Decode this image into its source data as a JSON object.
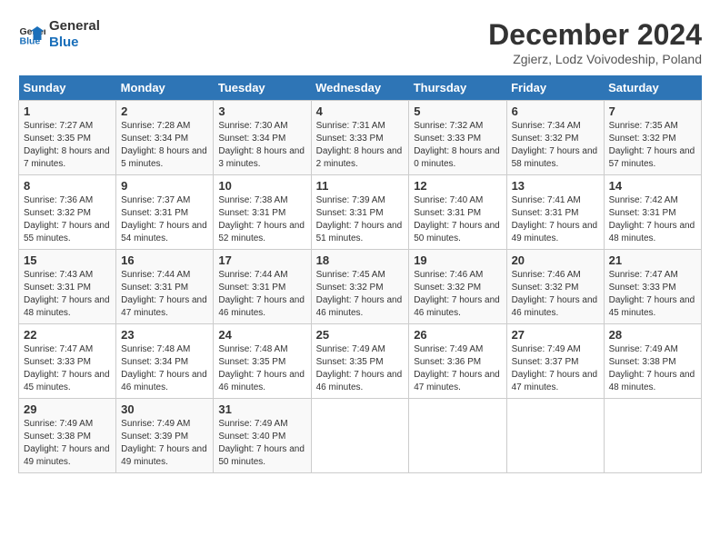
{
  "logo": {
    "line1": "General",
    "line2": "Blue"
  },
  "title": "December 2024",
  "subtitle": "Zgierz, Lodz Voivodeship, Poland",
  "days_of_week": [
    "Sunday",
    "Monday",
    "Tuesday",
    "Wednesday",
    "Thursday",
    "Friday",
    "Saturday"
  ],
  "weeks": [
    [
      {
        "day": "1",
        "sunrise": "7:27 AM",
        "sunset": "3:35 PM",
        "daylight": "8 hours and 7 minutes."
      },
      {
        "day": "2",
        "sunrise": "7:28 AM",
        "sunset": "3:34 PM",
        "daylight": "8 hours and 5 minutes."
      },
      {
        "day": "3",
        "sunrise": "7:30 AM",
        "sunset": "3:34 PM",
        "daylight": "8 hours and 3 minutes."
      },
      {
        "day": "4",
        "sunrise": "7:31 AM",
        "sunset": "3:33 PM",
        "daylight": "8 hours and 2 minutes."
      },
      {
        "day": "5",
        "sunrise": "7:32 AM",
        "sunset": "3:33 PM",
        "daylight": "8 hours and 0 minutes."
      },
      {
        "day": "6",
        "sunrise": "7:34 AM",
        "sunset": "3:32 PM",
        "daylight": "7 hours and 58 minutes."
      },
      {
        "day": "7",
        "sunrise": "7:35 AM",
        "sunset": "3:32 PM",
        "daylight": "7 hours and 57 minutes."
      }
    ],
    [
      {
        "day": "8",
        "sunrise": "7:36 AM",
        "sunset": "3:32 PM",
        "daylight": "7 hours and 55 minutes."
      },
      {
        "day": "9",
        "sunrise": "7:37 AM",
        "sunset": "3:31 PM",
        "daylight": "7 hours and 54 minutes."
      },
      {
        "day": "10",
        "sunrise": "7:38 AM",
        "sunset": "3:31 PM",
        "daylight": "7 hours and 52 minutes."
      },
      {
        "day": "11",
        "sunrise": "7:39 AM",
        "sunset": "3:31 PM",
        "daylight": "7 hours and 51 minutes."
      },
      {
        "day": "12",
        "sunrise": "7:40 AM",
        "sunset": "3:31 PM",
        "daylight": "7 hours and 50 minutes."
      },
      {
        "day": "13",
        "sunrise": "7:41 AM",
        "sunset": "3:31 PM",
        "daylight": "7 hours and 49 minutes."
      },
      {
        "day": "14",
        "sunrise": "7:42 AM",
        "sunset": "3:31 PM",
        "daylight": "7 hours and 48 minutes."
      }
    ],
    [
      {
        "day": "15",
        "sunrise": "7:43 AM",
        "sunset": "3:31 PM",
        "daylight": "7 hours and 48 minutes."
      },
      {
        "day": "16",
        "sunrise": "7:44 AM",
        "sunset": "3:31 PM",
        "daylight": "7 hours and 47 minutes."
      },
      {
        "day": "17",
        "sunrise": "7:44 AM",
        "sunset": "3:31 PM",
        "daylight": "7 hours and 46 minutes."
      },
      {
        "day": "18",
        "sunrise": "7:45 AM",
        "sunset": "3:32 PM",
        "daylight": "7 hours and 46 minutes."
      },
      {
        "day": "19",
        "sunrise": "7:46 AM",
        "sunset": "3:32 PM",
        "daylight": "7 hours and 46 minutes."
      },
      {
        "day": "20",
        "sunrise": "7:46 AM",
        "sunset": "3:32 PM",
        "daylight": "7 hours and 46 minutes."
      },
      {
        "day": "21",
        "sunrise": "7:47 AM",
        "sunset": "3:33 PM",
        "daylight": "7 hours and 45 minutes."
      }
    ],
    [
      {
        "day": "22",
        "sunrise": "7:47 AM",
        "sunset": "3:33 PM",
        "daylight": "7 hours and 45 minutes."
      },
      {
        "day": "23",
        "sunrise": "7:48 AM",
        "sunset": "3:34 PM",
        "daylight": "7 hours and 46 minutes."
      },
      {
        "day": "24",
        "sunrise": "7:48 AM",
        "sunset": "3:35 PM",
        "daylight": "7 hours and 46 minutes."
      },
      {
        "day": "25",
        "sunrise": "7:49 AM",
        "sunset": "3:35 PM",
        "daylight": "7 hours and 46 minutes."
      },
      {
        "day": "26",
        "sunrise": "7:49 AM",
        "sunset": "3:36 PM",
        "daylight": "7 hours and 47 minutes."
      },
      {
        "day": "27",
        "sunrise": "7:49 AM",
        "sunset": "3:37 PM",
        "daylight": "7 hours and 47 minutes."
      },
      {
        "day": "28",
        "sunrise": "7:49 AM",
        "sunset": "3:38 PM",
        "daylight": "7 hours and 48 minutes."
      }
    ],
    [
      {
        "day": "29",
        "sunrise": "7:49 AM",
        "sunset": "3:38 PM",
        "daylight": "7 hours and 49 minutes."
      },
      {
        "day": "30",
        "sunrise": "7:49 AM",
        "sunset": "3:39 PM",
        "daylight": "7 hours and 49 minutes."
      },
      {
        "day": "31",
        "sunrise": "7:49 AM",
        "sunset": "3:40 PM",
        "daylight": "7 hours and 50 minutes."
      },
      null,
      null,
      null,
      null
    ]
  ],
  "labels": {
    "sunrise": "Sunrise:",
    "sunset": "Sunset:",
    "daylight": "Daylight:"
  }
}
